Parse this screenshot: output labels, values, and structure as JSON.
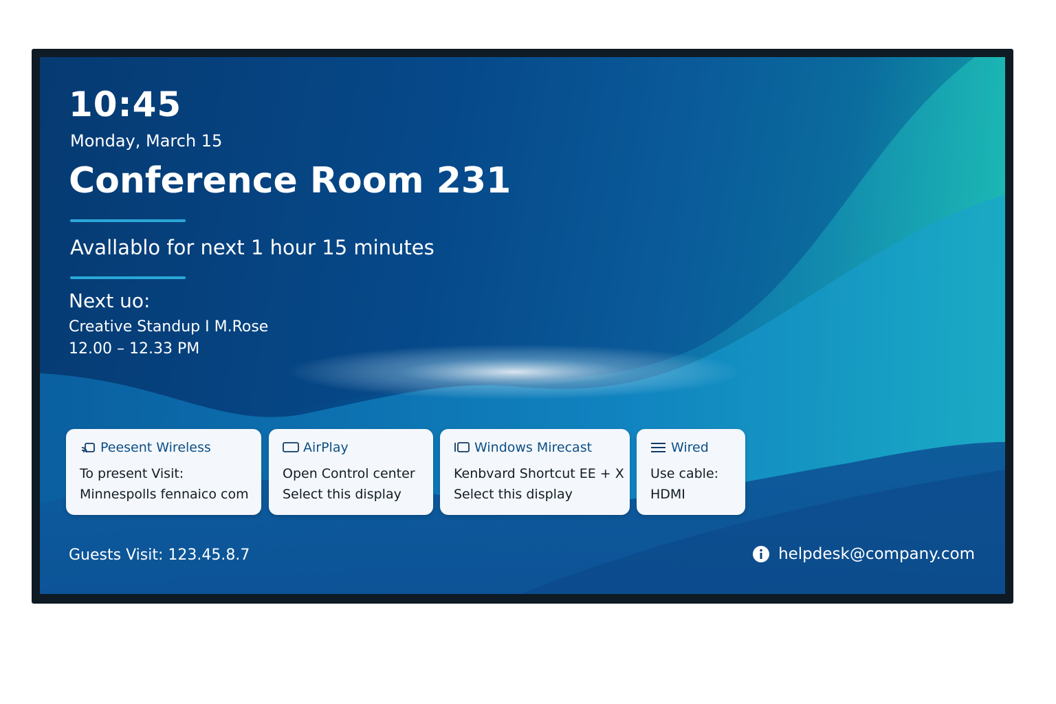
{
  "status": {
    "time": "10:45",
    "date": "Monday, March 15"
  },
  "room": {
    "name": "Conference Room 231",
    "availability": "Avallablo for next 1 hour 15 minutes"
  },
  "next_meeting": {
    "label": "Next uo:",
    "title": "Creative Standup I M.Rose",
    "time": "12.00 – 12.33 PM"
  },
  "cards": [
    {
      "icon": "cast-icon",
      "title": "Peesent Wireless",
      "line1": "To present Visit:",
      "line2": "Minnespolls fennaico com"
    },
    {
      "icon": "display-icon",
      "title": "AirPlay",
      "line1": "Open Control center",
      "line2": "Select this display"
    },
    {
      "icon": "window-icon",
      "title": "Windows Mirecast",
      "line1": "Kenbvard Shortcut EE + X",
      "line2": "Select this display"
    },
    {
      "icon": "menu-lines-icon",
      "title": "Wired",
      "line1": "Use cable:",
      "line2": "HDMI"
    }
  ],
  "footer": {
    "guests": "Guests Visit: 123.45.8.7",
    "helpdesk": "helpdesk@company.com"
  },
  "colors": {
    "accent_rule": "#2aa8d8",
    "card_bg": "#f4f7fb",
    "card_title": "#0b4f86",
    "bezel": "#0e1a24"
  }
}
